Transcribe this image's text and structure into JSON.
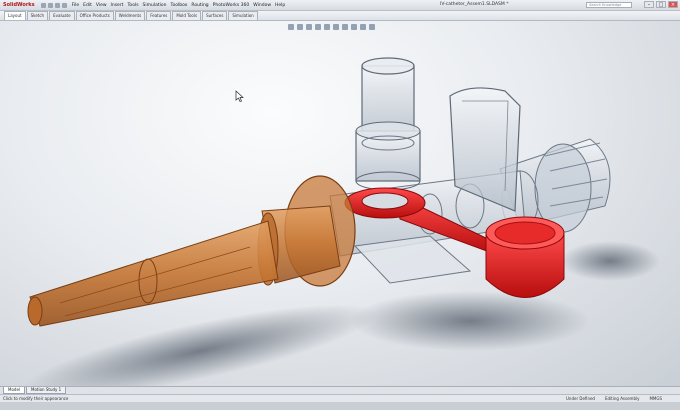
{
  "app": {
    "logo_text": "SolidWorks",
    "window_title": "IV-catheter_Assem1.SLDASM *",
    "menu": [
      "File",
      "Edit",
      "View",
      "Insert",
      "Tools",
      "Simulation",
      "Toolbox",
      "Routing",
      "PhotoWorks 360",
      "Window",
      "Help"
    ],
    "help_search_placeholder": "Search Knowledge"
  },
  "command_manager": {
    "tabs": [
      "Layout",
      "Sketch",
      "Evaluate",
      "Office Products",
      "Weldments",
      "Features",
      "Mold Tools",
      "Surfaces",
      "Simulation"
    ],
    "active_index": 0
  },
  "heads_up_toolbar": {
    "icons": [
      "zoom-to-fit-icon",
      "zoom-area-icon",
      "previous-view-icon",
      "section-view-icon",
      "view-orientation-icon",
      "display-style-icon",
      "hide-show-icon",
      "edit-appearance-icon",
      "apply-scene-icon",
      "view-settings-icon"
    ]
  },
  "bottom_tabs": {
    "items": [
      "Model",
      "Motion Study 1"
    ],
    "active_index": 0
  },
  "status": {
    "message": "Click to modify their appearance",
    "right": [
      "Under Defined",
      "Editing Assembly",
      "MMGS"
    ]
  },
  "colors": {
    "catheter_orange": "#c8793a",
    "clamp_red": "#e02020",
    "transparent_body": "#a9b4c2"
  }
}
